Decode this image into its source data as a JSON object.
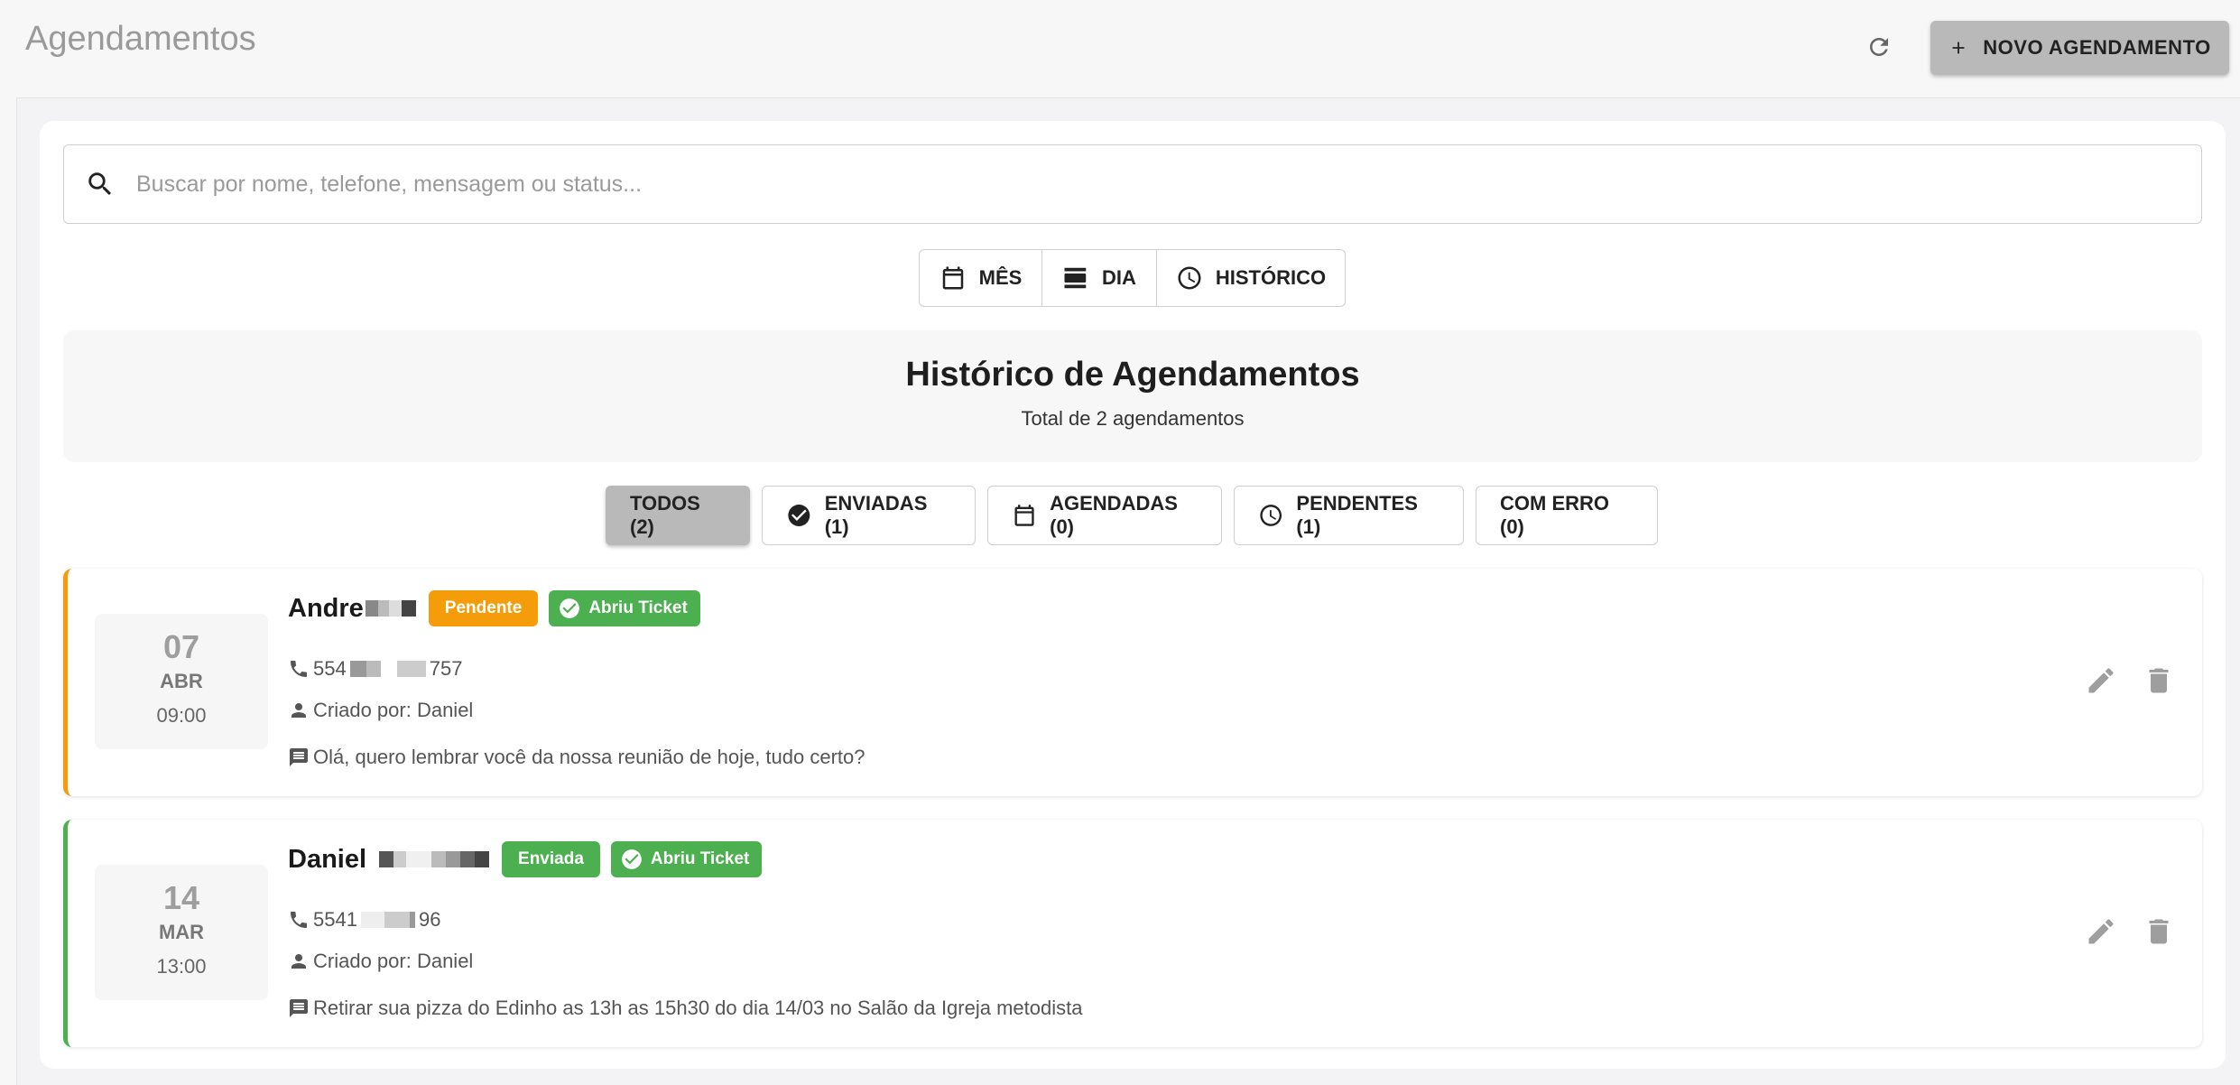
{
  "header": {
    "title": "Agendamentos",
    "new_button_label": "NOVO AGENDAMENTO"
  },
  "search": {
    "placeholder": "Buscar por nome, telefone, mensagem ou status...",
    "value": ""
  },
  "views": [
    {
      "label": "MÊS",
      "icon": "calendar-icon"
    },
    {
      "label": "DIA",
      "icon": "day-view-icon"
    },
    {
      "label": "HISTÓRICO",
      "icon": "clock-icon"
    }
  ],
  "history": {
    "title": "Histórico de Agendamentos",
    "subtitle": "Total de 2 agendamentos"
  },
  "filters": [
    {
      "label": "TODOS (2)",
      "active": true
    },
    {
      "label": "ENVIADAS (1)",
      "icon": "check-circle-icon"
    },
    {
      "label": "AGENDADAS (0)",
      "icon": "calendar-icon"
    },
    {
      "label": "PENDENTES (1)",
      "icon": "clock-icon"
    },
    {
      "label": "COM ERRO (0)"
    }
  ],
  "items": [
    {
      "day": "07",
      "month": "ABR",
      "time": "09:00",
      "name": "Andre",
      "status": "Pendente",
      "status_color": "#f59c0b",
      "ticket": "Abriu Ticket",
      "phone_prefix": "554",
      "phone_suffix": "757",
      "created_by": "Criado por: Daniel",
      "message": "Olá, quero lembrar você da nossa reunião de hoje, tudo certo?"
    },
    {
      "day": "14",
      "month": "MAR",
      "time": "13:00",
      "name": "Daniel",
      "status": "Enviada",
      "status_color": "#4caf50",
      "ticket": "Abriu Ticket",
      "phone_prefix": "5541",
      "phone_suffix": "96",
      "created_by": "Criado por: Daniel",
      "message": "Retirar sua pizza do Edinho as 13h as 15h30 do dia 14/03 no Salão da Igreja metodista"
    }
  ],
  "colors": {
    "pending": "#f59c0b",
    "sent": "#4caf50",
    "button_gray": "#b9b9b9"
  }
}
